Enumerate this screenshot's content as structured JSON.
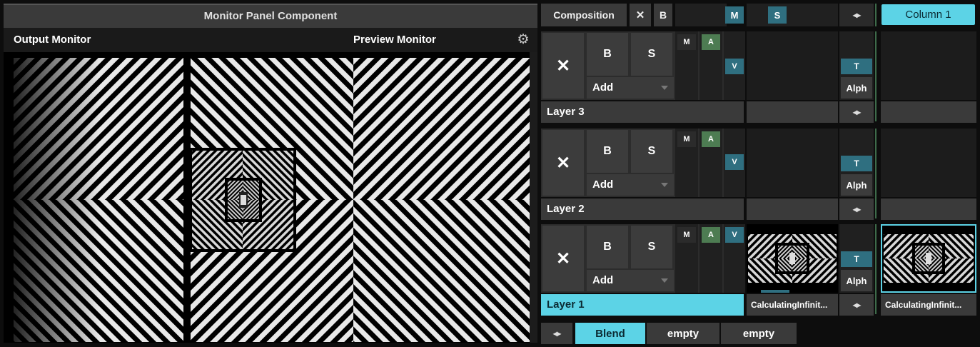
{
  "monitor": {
    "panel_title": "Monitor Panel Component",
    "output_label": "Output Monitor",
    "preview_label": "Preview Monitor",
    "settings_icon": "gear-icon"
  },
  "composition": {
    "label": "Composition",
    "close_glyph": "✕",
    "b_label": "B",
    "m_label": "M",
    "s_label": "S",
    "nav_glyph": "◂▸",
    "column_label": "Column 1"
  },
  "layers": [
    {
      "name": "Layer 3",
      "x_glyph": "✕",
      "b_label": "B",
      "s_label": "S",
      "blend_mode": "Add",
      "m_label": "M",
      "a_label": "A",
      "v_label": "V",
      "t_label": "T",
      "alpha_label": "Alph",
      "clip_name": "",
      "column_clip_name": "",
      "active": false
    },
    {
      "name": "Layer 2",
      "x_glyph": "✕",
      "b_label": "B",
      "s_label": "S",
      "blend_mode": "Add",
      "m_label": "M",
      "a_label": "A",
      "v_label": "V",
      "t_label": "T",
      "alpha_label": "Alph",
      "clip_name": "",
      "column_clip_name": "",
      "active": false
    },
    {
      "name": "Layer 1",
      "x_glyph": "✕",
      "b_label": "B",
      "s_label": "S",
      "blend_mode": "Add",
      "m_label": "M",
      "a_label": "A",
      "v_label": "V",
      "t_label": "T",
      "alpha_label": "Alph",
      "clip_name": "CalculatingInfinit...",
      "column_clip_name": "CalculatingInfinit...",
      "active": true
    }
  ],
  "bottom_bar": {
    "nav_glyph": "◂▸",
    "tabs": [
      "Blend",
      "empty",
      "empty"
    ],
    "selected": "Blend"
  },
  "colors": {
    "accent": "#5cd3e6",
    "teal": "#2f6f80",
    "green": "#4d7c52",
    "panel": "#3a3a3a",
    "background": "#0d0d0d"
  }
}
